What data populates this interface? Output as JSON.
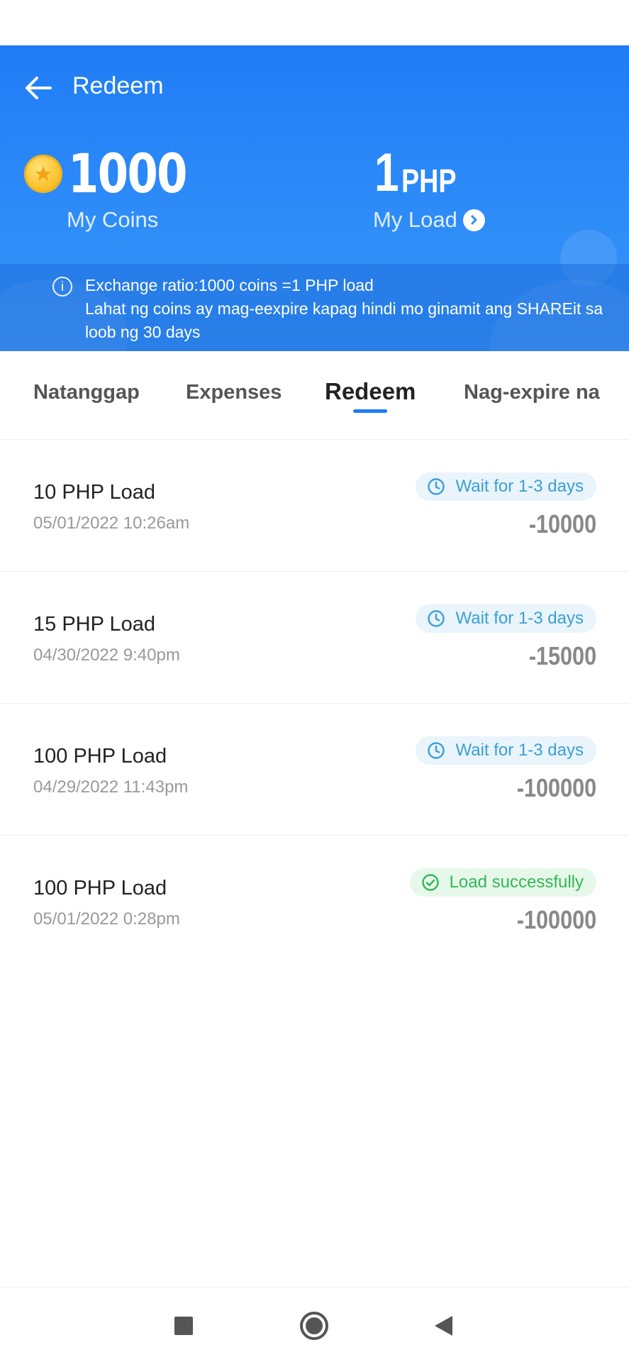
{
  "header": {
    "title": "Redeem",
    "coins_value": "1000",
    "coins_label": "My Coins",
    "load_value": "1",
    "load_unit": "PHP",
    "load_label": "My Load",
    "info_line1": "Exchange ratio:1000 coins =1 PHP load",
    "info_line2": "Lahat ng coins ay mag-eexpire kapag hindi mo ginamit ang SHAREit sa loob ng 30 days"
  },
  "tabs": [
    {
      "label": "Natanggap"
    },
    {
      "label": "Expenses"
    },
    {
      "label": "Redeem",
      "active": true
    },
    {
      "label": "Nag-expire na"
    }
  ],
  "items": [
    {
      "title": "10 PHP Load",
      "date": "05/01/2022 10:26am",
      "status": "Wait for 1-3 days",
      "status_type": "wait",
      "amount": "-10000"
    },
    {
      "title": "15 PHP Load",
      "date": "04/30/2022 9:40pm",
      "status": "Wait for 1-3 days",
      "status_type": "wait",
      "amount": "-15000"
    },
    {
      "title": "100 PHP Load",
      "date": "04/29/2022 11:43pm",
      "status": "Wait for 1-3 days",
      "status_type": "wait",
      "amount": "-100000"
    },
    {
      "title": "100 PHP Load",
      "date": "05/01/2022 0:28pm",
      "status": "Load successfully",
      "status_type": "ok",
      "amount": "-100000"
    }
  ],
  "colors": {
    "header_blue": "#1f7cf6",
    "wait_text": "#3a9fd6",
    "ok_text": "#35b656"
  },
  "icons": {
    "back": "arrow-left-icon",
    "coin": "coin-icon",
    "load_chevron": "chevron-right-circle-icon",
    "info": "info-icon",
    "wait": "clock-icon",
    "ok": "check-circle-icon",
    "nav_recents": "square-icon",
    "nav_home": "circle-icon",
    "nav_back": "triangle-back-icon"
  }
}
